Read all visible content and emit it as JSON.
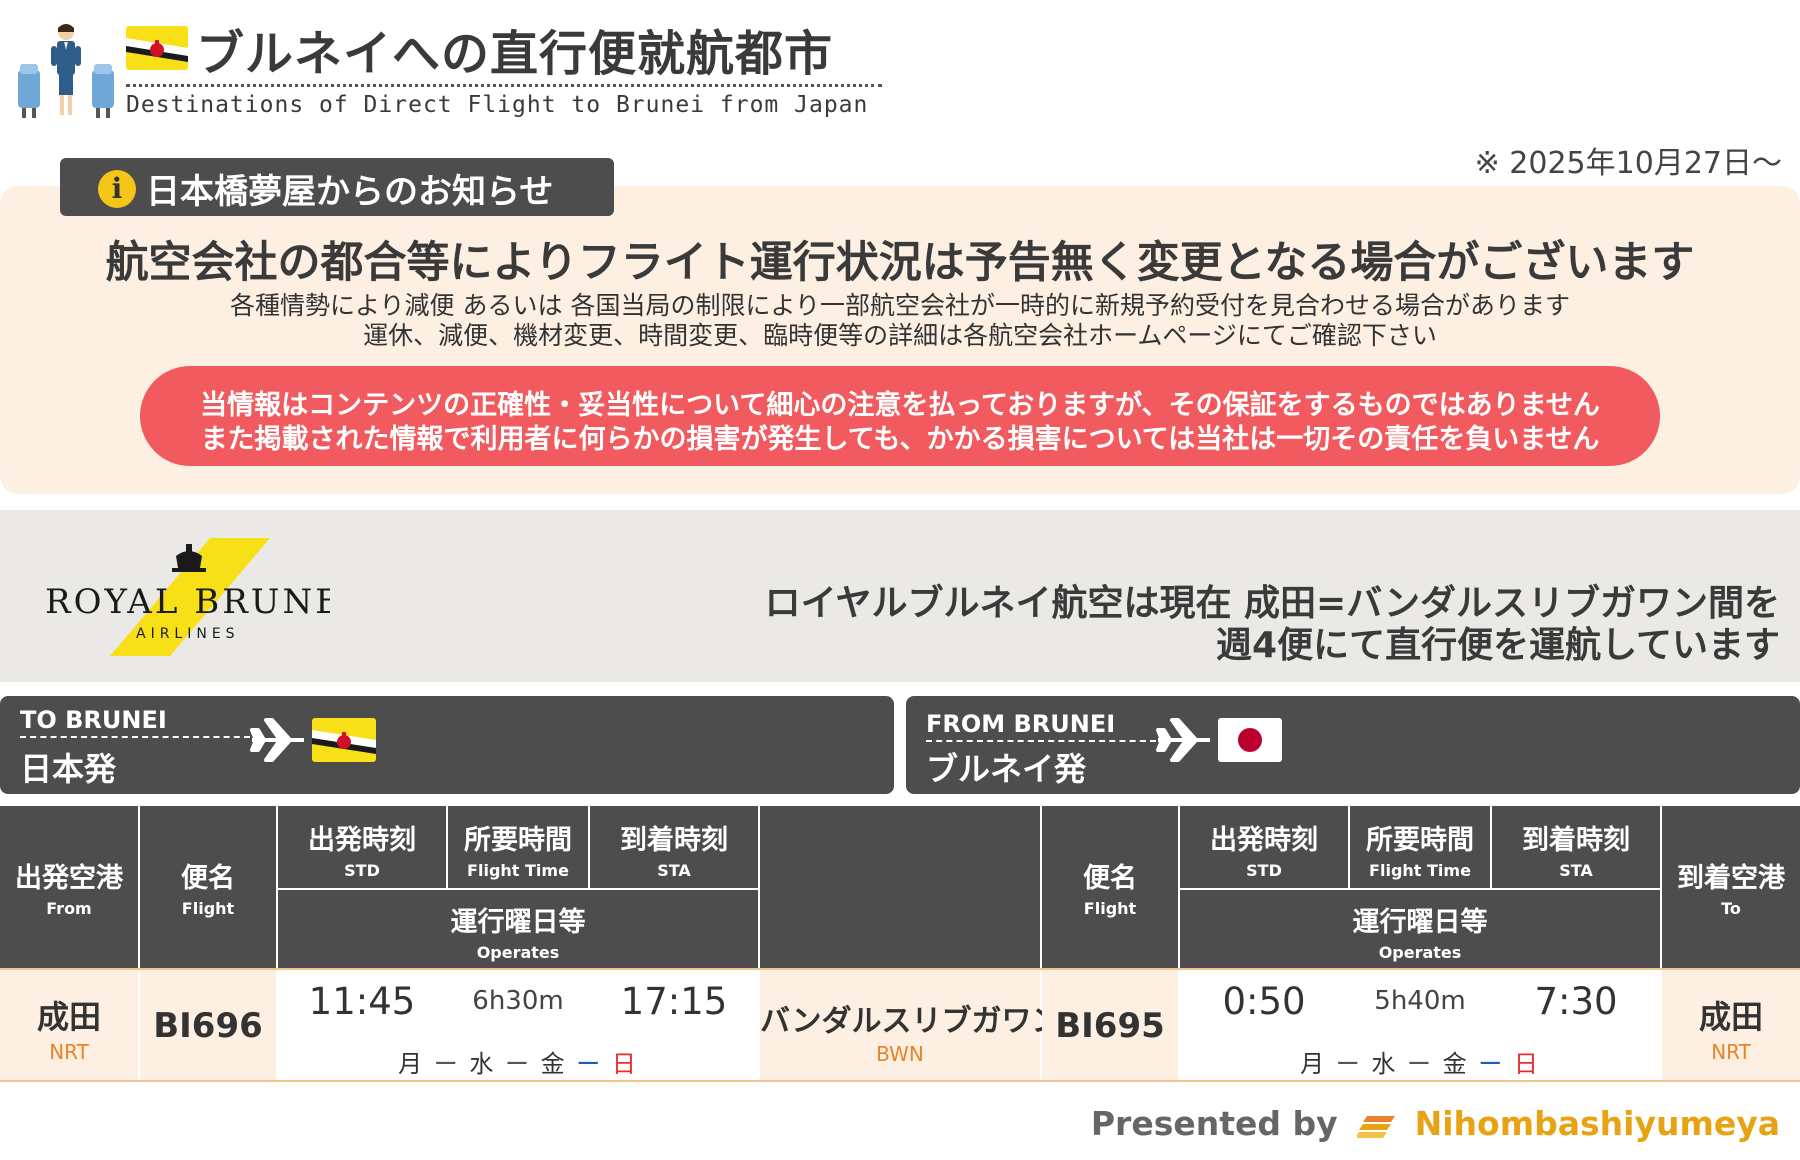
{
  "header": {
    "title": "ブルネイへの直行便就航都市",
    "subtitle": "Destinations of Direct Flight to Brunei from Japan",
    "effective_date": "※ 2025年10月27日〜"
  },
  "notice": {
    "tab_label": "日本橋夢屋からのお知らせ",
    "info_icon_glyph": "i",
    "heading": "航空会社の都合等によりフライト運行状況は予告無く変更となる場合がございます",
    "line1": "各種情勢により減便 あるいは 各国当局の制限により一部航空会社が一時的に新規予約受付を見合わせる場合があります",
    "line2": "運休、減便、機材変更、時間変更、臨時便等の詳細は各航空会社ホームページにてご確認下さい",
    "disclaimer_line1": "当情報はコンテンツの正確性・妥当性について細心の注意を払っておりますが、その保証をするものではありません",
    "disclaimer_line2": "また掲載された情報で利用者に何らかの損害が発生しても、かかる損害については当社は一切その責任を負いません"
  },
  "airline": {
    "logo_text_main": "ROYAL BRUNEI",
    "logo_text_sub": "AIRLINES",
    "description_line1": "ロイヤルブルネイ航空は現在 成田=バンダルスリブガワン間を",
    "description_line2": "週4便にて直行便を運航しています"
  },
  "directions": {
    "to": {
      "label_en": "TO BRUNEI",
      "label_ja": "日本発",
      "flag_icon": "brunei-flag-icon"
    },
    "from": {
      "label_en": "FROM BRUNEI",
      "label_ja": "ブルネイ発",
      "flag_icon": "japan-flag-icon"
    }
  },
  "table": {
    "headers": {
      "from_airport": {
        "ja": "出発空港",
        "en": "From"
      },
      "flight": {
        "ja": "便名",
        "en": "Flight"
      },
      "std": {
        "ja": "出発時刻",
        "en": "STD"
      },
      "flight_time": {
        "ja": "所要時間",
        "en": "Flight Time"
      },
      "sta": {
        "ja": "到着時刻",
        "en": "STA"
      },
      "operates": {
        "ja": "運行曜日等",
        "en": "Operates"
      },
      "to_airport": {
        "ja": "到着空港",
        "en": "To"
      }
    },
    "middle_airport": {
      "name": "バンダルスリブガワン",
      "code": "BWN"
    },
    "outbound": {
      "airport": "成田",
      "airport_code": "NRT",
      "flight": "BI696",
      "std": "11:45",
      "duration": "6h30m",
      "sta": "17:15",
      "days": [
        "月",
        "水",
        "金",
        "日"
      ],
      "separators": [
        "ー",
        "ー",
        "ー"
      ]
    },
    "inbound": {
      "airport": "成田",
      "airport_code": "NRT",
      "flight": "BI695",
      "std": "0:50",
      "duration": "5h40m",
      "sta": "7:30",
      "days": [
        "月",
        "水",
        "金",
        "日"
      ],
      "separators": [
        "ー",
        "ー",
        "ー"
      ]
    }
  },
  "footer": {
    "presented_label": "Presented by",
    "brand_name": "Nihombashiyumeya"
  },
  "colors": {
    "dark_header": "#4d4d4d",
    "notice_bg": "#fdf0e2",
    "disclaimer_red": "#f15b5f",
    "accent_orange": "#e8832a",
    "brand_yellow": "#e8a314",
    "sunday_red": "#e52d2d",
    "separator_blue": "#1a5fb4"
  }
}
